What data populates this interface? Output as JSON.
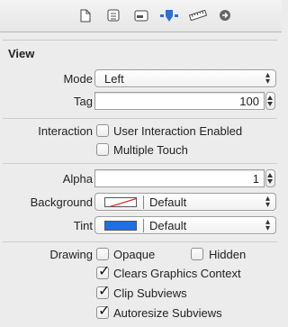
{
  "toolbar": {
    "tabs": [
      {
        "icon": "file-icon"
      },
      {
        "icon": "quick-help-icon"
      },
      {
        "icon": "identity-icon"
      },
      {
        "icon": "attributes-icon",
        "selected": true
      },
      {
        "icon": "size-ruler-icon"
      },
      {
        "icon": "connections-arrow-icon"
      }
    ]
  },
  "section": {
    "title": "View"
  },
  "mode": {
    "label": "Mode",
    "value": "Left"
  },
  "tag": {
    "label": "Tag",
    "value": "100"
  },
  "interaction": {
    "label": "Interaction",
    "user_interaction": {
      "label": "User Interaction Enabled",
      "checked": false
    },
    "multiple_touch": {
      "label": "Multiple Touch",
      "checked": false
    }
  },
  "alpha": {
    "label": "Alpha",
    "value": "1"
  },
  "background": {
    "label": "Background",
    "value": "Default",
    "swatch": "none-red-slash"
  },
  "tint": {
    "label": "Tint",
    "value": "Default",
    "swatch_color": "#1f6fe0"
  },
  "drawing": {
    "label": "Drawing",
    "opaque": {
      "label": "Opaque",
      "checked": false
    },
    "hidden": {
      "label": "Hidden",
      "checked": false
    },
    "clears_graphics_context": {
      "label": "Clears Graphics Context",
      "checked": true
    },
    "clip_subviews": {
      "label": "Clip Subviews",
      "checked": true
    },
    "autoresize_subviews": {
      "label": "Autoresize Subviews",
      "checked": true
    }
  },
  "colors": {
    "accent": "#1a63d6",
    "selected_tab": "#2a6fd8"
  }
}
